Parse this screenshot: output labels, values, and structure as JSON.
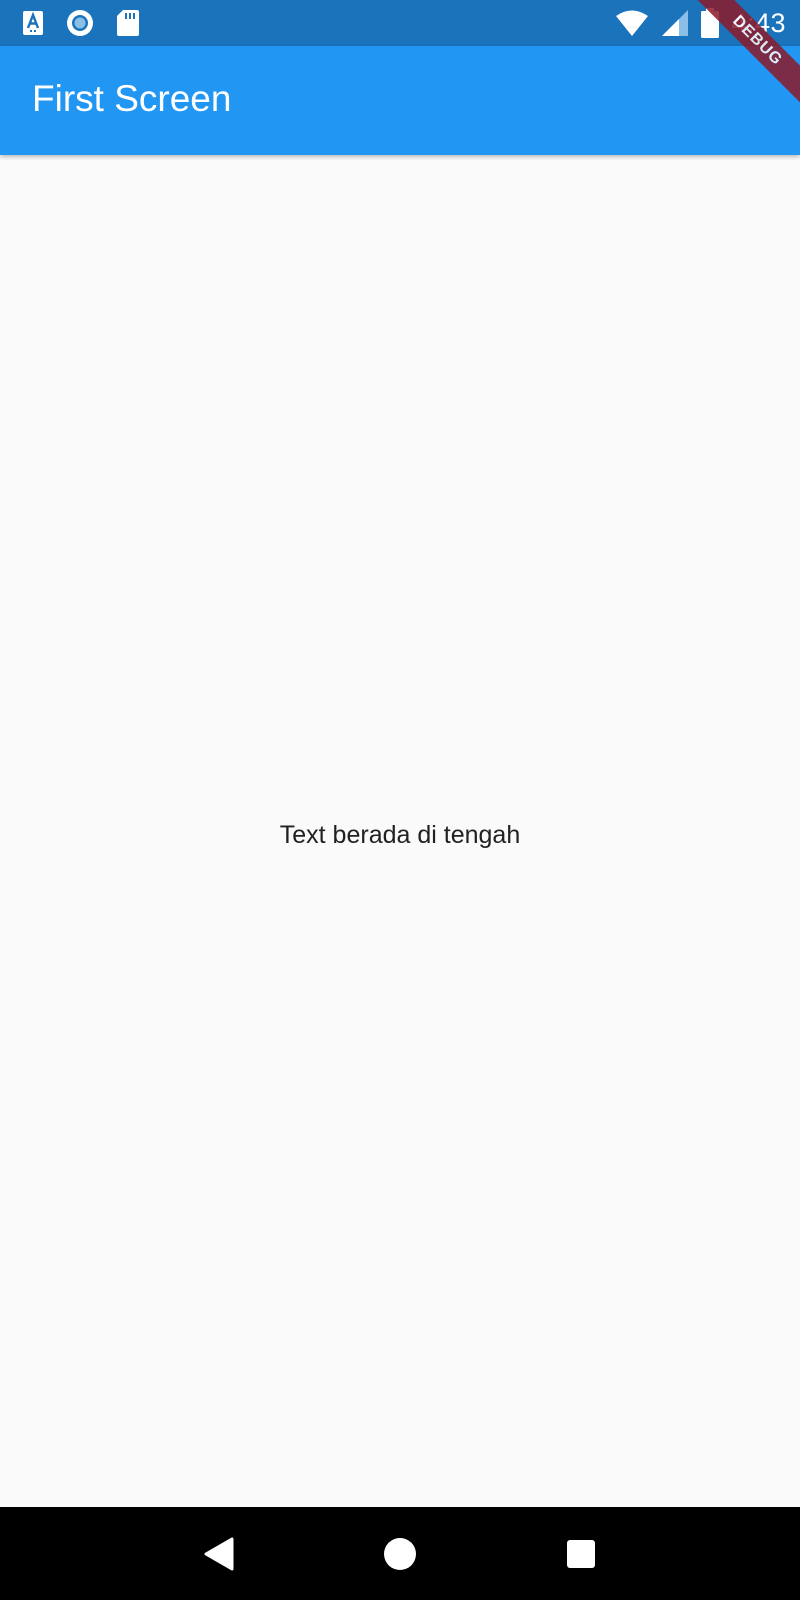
{
  "status_bar": {
    "time": "4:43",
    "left_icons": [
      "text-a-icon",
      "circle-record-icon",
      "sd-card-icon"
    ],
    "right_icons": [
      "wifi-icon",
      "cell-signal-icon",
      "battery-icon"
    ]
  },
  "app_bar": {
    "title": "First Screen",
    "color": "#2196f3"
  },
  "debug_banner": {
    "label": "DEBUG"
  },
  "body": {
    "center_text": "Text berada di tengah"
  },
  "nav_bar": {
    "buttons": [
      "back-icon",
      "home-icon",
      "recents-icon"
    ]
  }
}
